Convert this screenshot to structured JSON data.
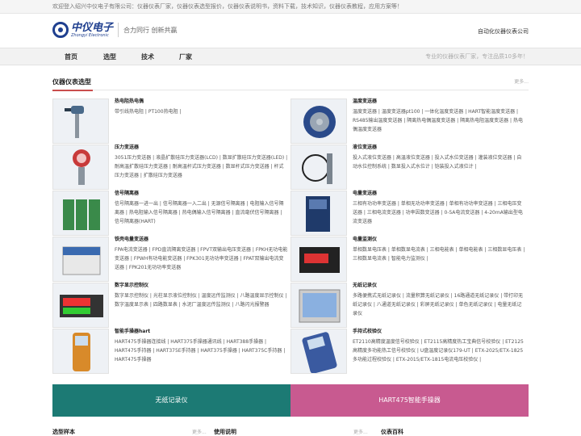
{
  "topbar": {
    "text": "欢迎登入绍兴中仪电子有限公司：仪器仪表厂家，仪器仪表选型报价，仪器仪表说明书，资料下载，技术知识，仪器仪表教程，应用方案等！"
  },
  "header": {
    "logo_cn": "中仪电子",
    "logo_en": "Zhongyi Electronic",
    "slogan": "合力同行 创新共赢",
    "right_text": "自动化仪器仪表公司"
  },
  "nav": {
    "items": [
      {
        "label": "首页"
      },
      {
        "label": "选型"
      },
      {
        "label": "技术"
      },
      {
        "label": "厂家"
      }
    ],
    "right_text": "专业的仪器仪表厂家，专注品质10多年！"
  },
  "section": {
    "title": "仪器仪表选型",
    "more": "更多..."
  },
  "products": [
    {
      "title": "热电阻热电偶",
      "links": "带引线热电阻 | PT100热电阻 |",
      "icon": "thermocouple-icon"
    },
    {
      "title": "温度变送器",
      "links": "温度变送器 | 温度变送器pt100 | 一体化温度变送器 | HART智能温度变送器 | RS485输出温度变送器 | 隔离热电偶温度变送器 | 隔离热电阻温度变送器 | 热电偶温度变送器",
      "icon": "temperature-transmitter-icon"
    },
    {
      "title": "压力变送器",
      "links": "3051压力变送器 | 液晶扩散硅压力变送器(LCD) | 数显扩散硅压力变送器(LED) | 耐高温扩散硅压力变送器 | 耐高温杆式压力变送器 | 数显杆式压力变送器 | 杆式压力变送器 | 扩散硅压力变送器",
      "icon": "pressure-transmitter-icon"
    },
    {
      "title": "液位变送器",
      "links": "投入式液位变送器 | 高温液位变送器 | 投入式水位变送器 | 灌装液位变送器 | 自动水位控制系统 | 数显投入式水位计 | 铠装投入式液位计 |",
      "icon": "level-transmitter-icon"
    },
    {
      "title": "信号隔离器",
      "links": "信号隔离器一进一出 | 信号隔离器一入二出 | 无源信号隔离器 | 电阻输入信号隔离器 | 热电阻输入信号隔离器 | 热电偶输入信号隔离器 | 直流毫伏信号隔离器 | 信号隔离器(HART)",
      "icon": "signal-isolator-icon"
    },
    {
      "title": "电量变送器",
      "links": "三相有功功率变送器 | 单相无功功率变送器 | 单相有功功率变送器 | 三相电压变送器 | 三相电流变送器 | 功率因数变送器 | 0-5A电流变送器 | 4-20mA输出型电流变送器",
      "icon": "power-transmitter-icon"
    },
    {
      "title": "铁壳电量变送器",
      "links": "FPA电流变送器 | FPD直流隔离变送器 | FPVT双输出电压变送器 | FPKH无功电能变送器 | FPWH有功电能变送器 | FPK301无功功率变送器 | FPAT双输出电流变送器 | FPK201无功功率变送器",
      "icon": "iron-shell-transmitter-icon"
    },
    {
      "title": "电量监测仪",
      "links": "单相数显电压表 | 单相数显电流表 | 三相电能表 | 单相电能表 | 三相数显电压表 | 三相数显电流表 | 智能电力监测仪 |",
      "icon": "power-meter-icon"
    },
    {
      "title": "数字显示控制仪",
      "links": "数字显示控制仪 | 光柱显示液位控制仪 | 温度远传监测仪 | 八路温度显示控制仪 | 数字温度显示表 | 四路数显表 | 水泥厂温度远传监测仪 | 八路闪光报警器",
      "icon": "digital-controller-icon"
    },
    {
      "title": "无纸记录仪",
      "links": "多路便携式无纸记录仪 | 流量积算无纸记录仪 | 16路通道无纸记录仪 | 带打印无纸记录仪 | 八通道无纸记录仪 | 彩屏无纸记录仪 | 单色无纸记录仪 | 电量无纸记录仪",
      "icon": "paperless-recorder-icon"
    },
    {
      "title": "智能手操器hart",
      "links": "HART475手操器连接线 | HART375手操器通讯线 | HART388手操器 | HART475手持器 | HART375E手持器 | HART375手操器 | HART375C手持器 | HART475手操器",
      "icon": "hart-communicator-icon"
    },
    {
      "title": "手持式校验仪",
      "links": "ET2110高精度温度信号校验仪 | ET2115高精度热工宝典信号校验仪 | ET2125高精度多功能热工信号校验仪 | U盘温度记录仪179-UT | ETX-2025/ETX-1825多功能过程校验仪 | ETX-2015/ETX-1815电流电压校验仪 |",
      "icon": "handheld-calibrator-icon"
    }
  ],
  "banners": [
    {
      "label": "无纸记录仪",
      "color": "#1c7a74"
    },
    {
      "label": "HART475智能手操器",
      "color": "#c85a90"
    }
  ],
  "bottom": {
    "col1_title": "选型样本",
    "col1_more": "更多...",
    "col2_title": "使用说明",
    "col2_more": "更多...",
    "col3_title": "仪表百科"
  }
}
